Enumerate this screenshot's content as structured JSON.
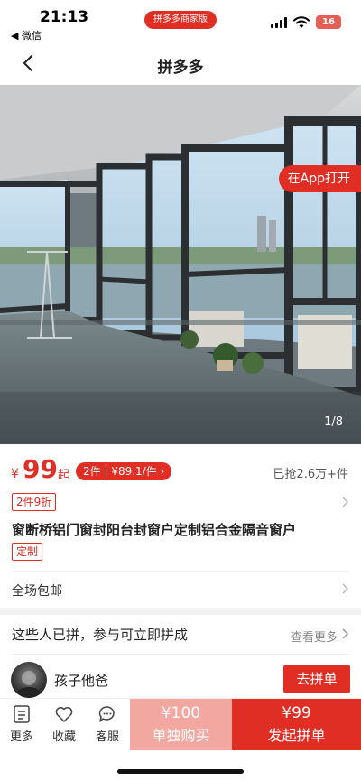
{
  "status_bar": {
    "time": "21:13",
    "back_app": "◀ 微信",
    "merchant_pill": "拼多多商家版",
    "battery": "16"
  },
  "nav": {
    "title": "拼多多",
    "back_icon": "chevron-left-icon"
  },
  "gallery": {
    "open_in_app": "在App打开",
    "counter": "1/8"
  },
  "price": {
    "currency": "¥",
    "value": "99",
    "suffix": "起",
    "promo_pill": "2件 | ¥89.1/件 ›",
    "sold": "已抢2.6万+件"
  },
  "discount_tag": "2件9折",
  "product": {
    "title": "窗断桥铝门窗封阳台封窗户定制铝合金隔音窗户",
    "custom_tag": "定制"
  },
  "shipping": {
    "label": "全场包邮"
  },
  "group_buy": {
    "header": "这些人已拼，参与可立即拼成",
    "see_more": "查看更多",
    "user_name": "孩子他爸",
    "join_label": "去拼单"
  },
  "bottom_bar": {
    "more_label": "更多",
    "favorite_label": "收藏",
    "service_label": "客服",
    "single_price": "¥100",
    "single_label": "单独购买",
    "group_price": "¥99",
    "group_label": "发起拼单"
  },
  "colors": {
    "brand_red": "#e02e24",
    "light_red": "#f3a7a1"
  }
}
